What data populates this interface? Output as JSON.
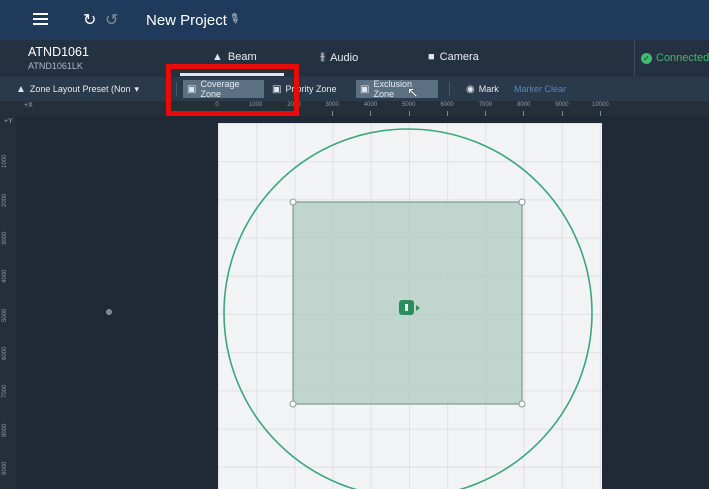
{
  "header": {
    "project_name": "New Project",
    "menu_icon": "hamburger-icon",
    "undo_icon": "undo-icon",
    "redo_icon": "redo-icon"
  },
  "device": {
    "name": "ATND1061",
    "model": "ATND1061LK"
  },
  "device_tabs": [
    {
      "label": "Beam",
      "icon": "microphone-icon",
      "active": true
    },
    {
      "label": "Audio",
      "icon": "sliders-icon"
    },
    {
      "label": "Camera",
      "icon": "camera-icon"
    }
  ],
  "status": {
    "label": "Connected",
    "color": "#3fba6e"
  },
  "toolbar": {
    "preset_label": "Zone Layout Preset (Non",
    "coverage_label": "Coverage Zone",
    "priority_label": "Priority Zone",
    "exclusion_label": "Exclusion Zone",
    "mark_label": "Mark",
    "marker_clear_label": "Marker Clear"
  },
  "ruler": {
    "x_axis_label": "+X",
    "y_axis_label": "+Y",
    "x_ticks": [
      "0",
      "1000",
      "2000",
      "3000",
      "4000",
      "5000",
      "6000",
      "7000",
      "8000",
      "9000",
      "10000"
    ],
    "y_ticks": [
      "1000",
      "2000",
      "3000",
      "4000",
      "5000",
      "6000",
      "7000",
      "8000",
      "9000"
    ]
  },
  "zone": {
    "circle_color": "#3aa77a",
    "square_fill": "#aecbc0",
    "square_stroke": "#7f9a8f"
  },
  "colors": {
    "title_bar": "#1f3a5a",
    "highlight": "#e80b0b",
    "device_icon": "#2e8b5c"
  }
}
